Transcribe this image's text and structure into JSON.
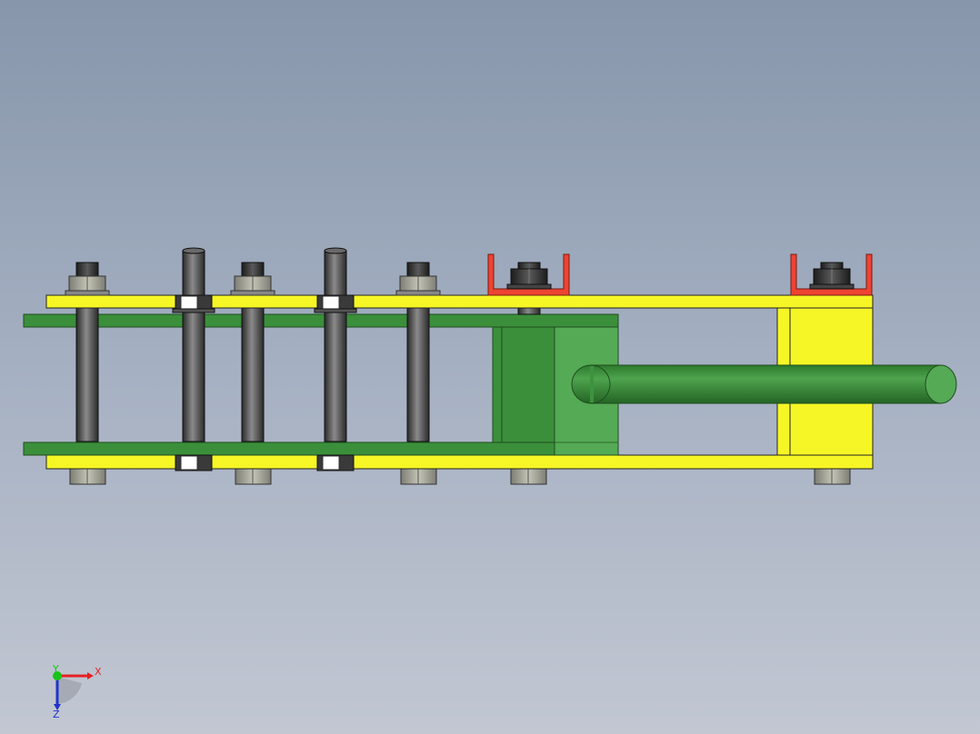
{
  "triad": {
    "x_label": "X",
    "y_label": "Y",
    "z_label": "Z",
    "x_color": "#e52222",
    "y_color": "#18c418",
    "z_color": "#2233cc"
  },
  "colors": {
    "plate_yellow": "#f6f626",
    "plate_green": "#3b8f3b",
    "block_green": "#55aa55",
    "bracket_red": "#ee4433",
    "rod_green": "#3a8d3a",
    "stud_dark": "#3d3d3d",
    "nut_gray": "#a8a89a"
  }
}
